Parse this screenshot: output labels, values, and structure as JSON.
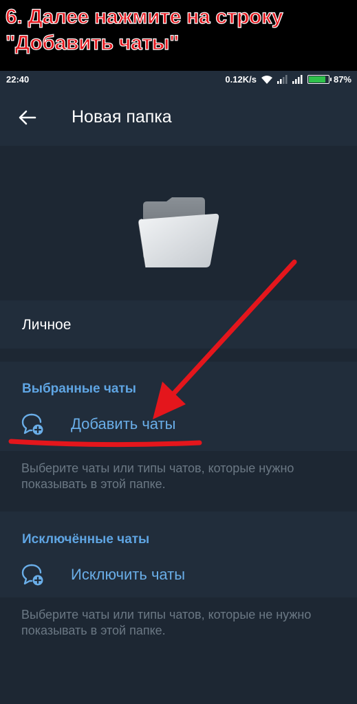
{
  "banner": {
    "line1": "6. Далее нажмите на строку",
    "line2": "\"Добавить чаты\""
  },
  "status_bar": {
    "time": "22:40",
    "speed": "0.12K/s",
    "battery": "87%",
    "battery_level": 0.87,
    "battery_color": "#2fc14b"
  },
  "toolbar": {
    "title": "Новая папка",
    "back_icon": "arrow-left-icon"
  },
  "folder": {
    "icon": "folder-icon"
  },
  "name_field": {
    "value": "Личное"
  },
  "included": {
    "header": "Выбранные чаты",
    "action_label": "Добавить чаты",
    "action_icon": "add-chat-icon",
    "note": "Выберите чаты или типы чатов, которые нужно показывать в этой папке."
  },
  "excluded": {
    "header": "Исключённые чаты",
    "action_label": "Исключить чаты",
    "action_icon": "add-chat-icon",
    "note": "Выберите чаты или типы чатов, которые не нужно показывать в этой папке."
  },
  "colors": {
    "accent": "#5fa5e3",
    "annotation": "#e4161c",
    "background": "#1d2733",
    "surface": "#212d3b"
  }
}
